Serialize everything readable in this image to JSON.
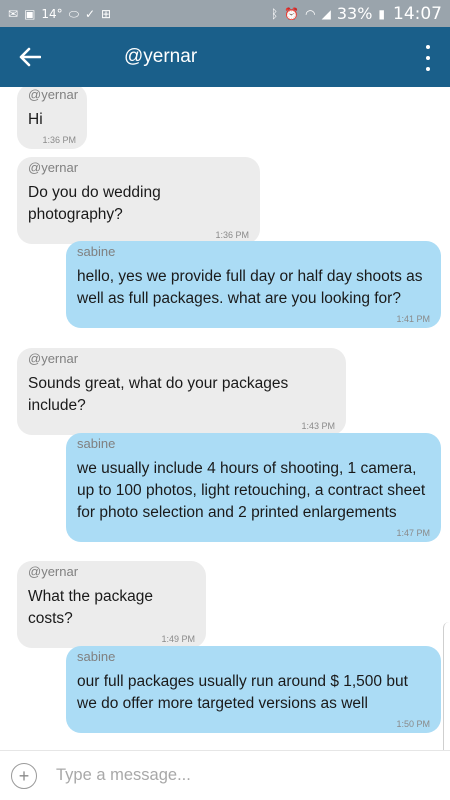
{
  "status_bar": {
    "left_icons": [
      "gmail-icon",
      "gallery-icon",
      "temperature-text",
      "message-icon",
      "check-icon",
      "gamepad-icon"
    ],
    "temperature": "14°",
    "battery": "33%",
    "time": "14:07"
  },
  "header": {
    "title": "@yernar"
  },
  "messages": [
    {
      "direction": "in",
      "sender": "@yernar",
      "text": "Hi",
      "time": "1:36 PM"
    },
    {
      "direction": "in",
      "sender": "@yernar",
      "text": "Do you do wedding photography?",
      "time": "1:36 PM"
    },
    {
      "direction": "out",
      "sender": "sabine",
      "text": "hello,  yes we provide full day or half day shoots as well as full packages. what are you looking for?",
      "time": "1:41 PM"
    },
    {
      "direction": "in",
      "sender": "@yernar",
      "text": "Sounds great, what do your packages include?",
      "time": "1:43 PM"
    },
    {
      "direction": "out",
      "sender": "sabine",
      "text": "we usually include 4 hours of shooting,  1 camera,  up to 100 photos, light retouching,  a contract sheet for photo selection and 2 printed  enlargements",
      "time": "1:47 PM"
    },
    {
      "direction": "in",
      "sender": "@yernar",
      "text": "What the package costs?",
      "time": "1:49 PM"
    },
    {
      "direction": "out",
      "sender": "sabine",
      "text": "our full packages usually run around $ 1,500 but we do offer more targeted versions as well",
      "time": "1:50 PM"
    }
  ],
  "composer": {
    "placeholder": "Type a message..."
  },
  "colors": {
    "app_bar": "#1a5f8a",
    "status_bar": "#9aa4ac",
    "incoming_bubble": "#ececec",
    "outgoing_bubble": "#abdcf5"
  }
}
